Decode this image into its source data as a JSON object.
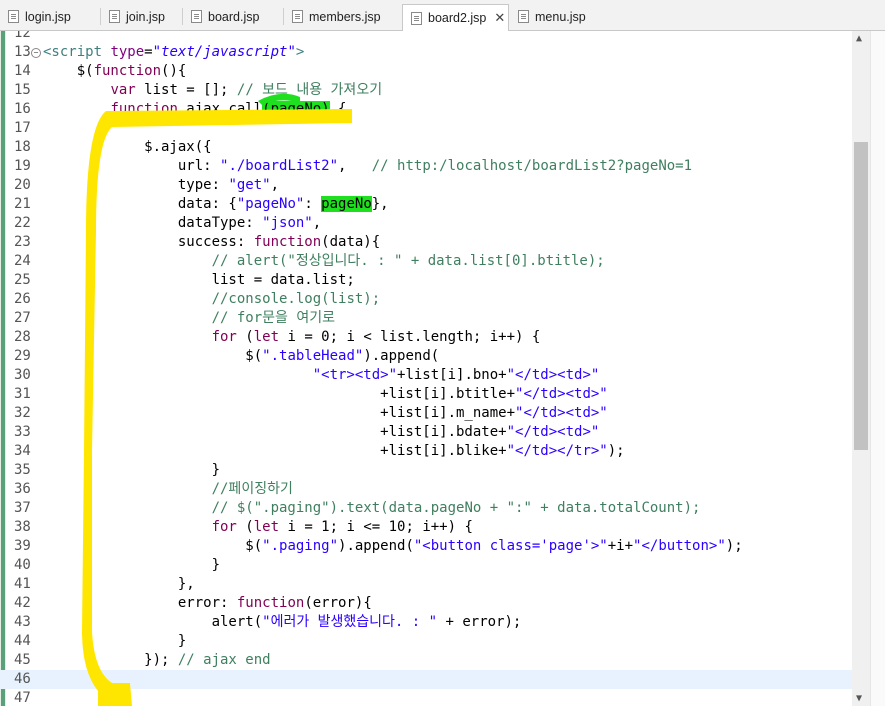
{
  "tabs": [
    {
      "label": "login.jsp",
      "active": false
    },
    {
      "label": "join.jsp",
      "active": false
    },
    {
      "label": "board.jsp",
      "active": false
    },
    {
      "label": "members.jsp",
      "active": false
    },
    {
      "label": "board2.jsp",
      "active": true
    },
    {
      "label": "menu.jsp",
      "active": false
    }
  ],
  "editor": {
    "lines": [
      {
        "n": "12",
        "html": ""
      },
      {
        "n": "13",
        "html": "<span class=\"ta\">&lt;script</span> <span class=\"at\">type</span>=<span class=\"it\">\"text/javascript\"</span><span class=\"ta\">&gt;</span>"
      },
      {
        "n": "14",
        "html": "    $(<span class=\"kw\">function</span>(){"
      },
      {
        "n": "15",
        "html": "        <span class=\"kw\">var</span> list = []; <span class=\"cm\">// 보드 내용 가져오기</span>"
      },
      {
        "n": "16",
        "html": "        <span class=\"kw\">function</span> ajax_call<span class=\"hl\">(pageNo)</span> {"
      },
      {
        "n": "17",
        "html": ""
      },
      {
        "n": "18",
        "html": "            $.ajax({"
      },
      {
        "n": "19",
        "html": "                url: <span class=\"st\">\"./boardList2\"</span>,   <span class=\"cm\">// http:/localhost/boardList2?pageNo=1</span>"
      },
      {
        "n": "20",
        "html": "                type: <span class=\"st\">\"get\"</span>,"
      },
      {
        "n": "21",
        "html": "                data: {<span class=\"st\">\"pageNo\"</span>: <span class=\"hl\">pageNo</span>},"
      },
      {
        "n": "22",
        "html": "                dataType: <span class=\"st\">\"json\"</span>,"
      },
      {
        "n": "23",
        "html": "                success: <span class=\"kw\">function</span>(data){"
      },
      {
        "n": "24",
        "html": "                    <span class=\"cm\">// alert(\"정상입니다. : \" + data.list[0].btitle);</span>"
      },
      {
        "n": "25",
        "html": "                    list = data.list;"
      },
      {
        "n": "26",
        "html": "                    <span class=\"cm\">//console.log(list);</span>"
      },
      {
        "n": "27",
        "html": "                    <span class=\"cm\">// for문을 여기로</span>"
      },
      {
        "n": "28",
        "html": "                    <span class=\"kw\">for</span> (<span class=\"kw\">let</span> i = 0; i &lt; list.length; i++) {"
      },
      {
        "n": "29",
        "html": "                        $(<span class=\"st\">\".tableHead\"</span>).append("
      },
      {
        "n": "30",
        "html": "                                <span class=\"st\">\"&lt;tr&gt;&lt;td&gt;\"</span>+list[i].bno+<span class=\"st\">\"&lt;/td&gt;&lt;td&gt;\"</span>"
      },
      {
        "n": "31",
        "html": "                                        +list[i].btitle+<span class=\"st\">\"&lt;/td&gt;&lt;td&gt;\"</span>"
      },
      {
        "n": "32",
        "html": "                                        +list[i].m_name+<span class=\"st\">\"&lt;/td&gt;&lt;td&gt;\"</span>"
      },
      {
        "n": "33",
        "html": "                                        +list[i].bdate+<span class=\"st\">\"&lt;/td&gt;&lt;td&gt;\"</span>"
      },
      {
        "n": "34",
        "html": "                                        +list[i].blike+<span class=\"st\">\"&lt;/td&gt;&lt;/tr&gt;\"</span>);"
      },
      {
        "n": "35",
        "html": "                    }"
      },
      {
        "n": "36",
        "html": "                    <span class=\"cm\">//페이징하기</span>"
      },
      {
        "n": "37",
        "html": "                    <span class=\"cm\">// $(\".paging\").text(data.pageNo + \":\" + data.totalCount);</span>"
      },
      {
        "n": "38",
        "html": "                    <span class=\"kw\">for</span> (<span class=\"kw\">let</span> i = 1; i &lt;= 10; i++) {"
      },
      {
        "n": "39",
        "html": "                        $(<span class=\"st\">\".paging\"</span>).append(<span class=\"st\">\"&lt;button class='page'&gt;\"</span>+i+<span class=\"st\">\"&lt;/button&gt;\"</span>);"
      },
      {
        "n": "40",
        "html": "                    }"
      },
      {
        "n": "41",
        "html": "                },"
      },
      {
        "n": "42",
        "html": "                error: <span class=\"kw\">function</span>(error){"
      },
      {
        "n": "43",
        "html": "                    alert(<span class=\"st\">\"에러가 발생했습니다. : \"</span> + error);"
      },
      {
        "n": "44",
        "html": "                }"
      },
      {
        "n": "45",
        "html": "            }); <span class=\"cm\">// ajax end</span>"
      },
      {
        "n": "46",
        "html": ""
      },
      {
        "n": "47",
        "html": "        }"
      }
    ]
  },
  "colors": {
    "keyword": "#7f0055",
    "string": "#2a00ff",
    "comment": "#3f7f5f",
    "highlight_green": "#1ee01e",
    "annotation_yellow": "#ffe600"
  }
}
